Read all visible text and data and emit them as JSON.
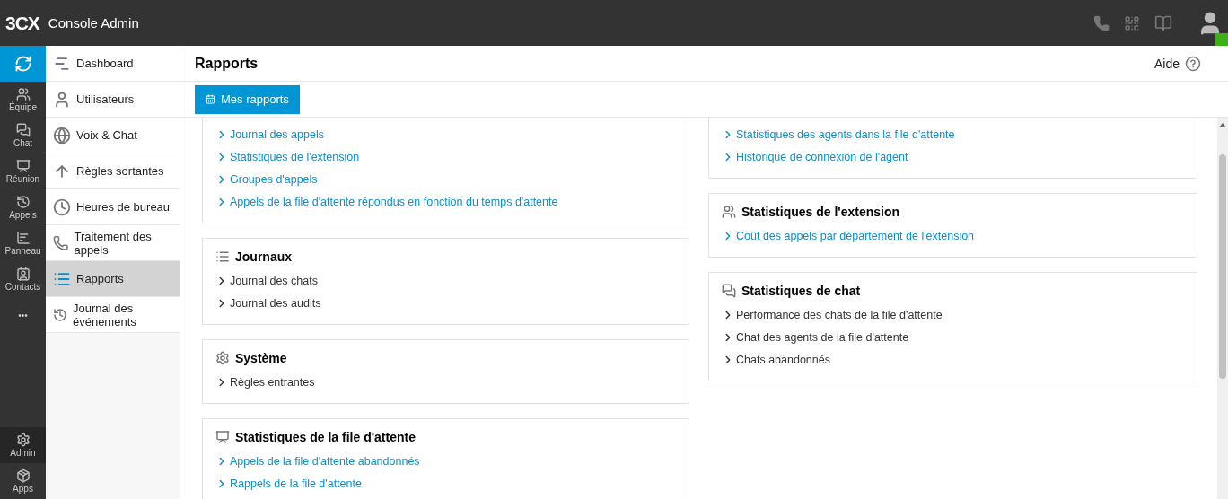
{
  "app": {
    "brand": "3CX",
    "title": "Console Admin"
  },
  "user": {
    "online": true
  },
  "rail": {
    "top": [
      {
        "selected": true
      },
      {
        "label": "Équipe",
        "selected": false
      },
      {
        "label": "Chat",
        "selected": false
      },
      {
        "label": "Réunion",
        "selected": false
      },
      {
        "label": "Appels",
        "selected": false
      },
      {
        "label": "Panneau",
        "selected": false
      },
      {
        "label": "Contacts",
        "selected": false
      },
      {
        "label": "•••",
        "selected": false
      }
    ],
    "bottom": [
      {
        "label": "Admin",
        "selected": true
      },
      {
        "label": "Apps",
        "selected": false
      }
    ]
  },
  "sidebar": {
    "items": [
      {
        "label": "Dashboard",
        "selected": false
      },
      {
        "label": "Utilisateurs",
        "selected": false
      },
      {
        "label": "Voix & Chat",
        "selected": false
      },
      {
        "label": "Règles sortantes",
        "selected": false
      },
      {
        "label": "Heures de bureau",
        "selected": false
      },
      {
        "label": "Traitement des appels",
        "selected": false
      },
      {
        "label": "Rapports",
        "selected": true
      },
      {
        "label": "Journal des événements",
        "selected": false
      }
    ]
  },
  "header": {
    "title": "Rapports",
    "help": "Aide"
  },
  "toolbar": {
    "button": "Mes rapports"
  },
  "columns": [
    [
      {
        "items": [
          {
            "kind": "link",
            "label": "Journal des appels"
          },
          {
            "kind": "link",
            "label": "Statistiques de l'extension"
          },
          {
            "kind": "link",
            "label": "Groupes d'appels"
          },
          {
            "kind": "link",
            "label": "Appels de la file d'attente répondus en fonction du temps d'attente"
          }
        ]
      },
      {
        "title": "Journaux",
        "items": [
          {
            "kind": "plain",
            "label": "Journal des chats"
          },
          {
            "kind": "plain",
            "label": "Journal des audits"
          }
        ]
      },
      {
        "title": "Système",
        "items": [
          {
            "kind": "plain",
            "label": "Règles entrantes"
          }
        ]
      },
      {
        "title": "Statistiques de la file d'attente",
        "items": [
          {
            "kind": "link",
            "label": "Appels de la file d'attente abandonnés"
          },
          {
            "kind": "link",
            "label": "Rappels de la file d'attente"
          }
        ]
      }
    ],
    [
      {
        "items": [
          {
            "kind": "link",
            "label": "Statistiques des agents dans la file d'attente"
          },
          {
            "kind": "link",
            "label": "Historique de connexion de l'agent"
          }
        ]
      },
      {
        "title": "Statistiques de l'extension",
        "items": [
          {
            "kind": "link",
            "label": "Coût des appels par département de l'extension"
          }
        ]
      },
      {
        "title": "Statistiques de chat",
        "items": [
          {
            "kind": "plain",
            "label": "Performance des chats de la file d'attente"
          },
          {
            "kind": "plain",
            "label": "Chat des agents de la file d'attente"
          },
          {
            "kind": "plain",
            "label": "Chats abandonnés"
          }
        ]
      }
    ]
  ]
}
